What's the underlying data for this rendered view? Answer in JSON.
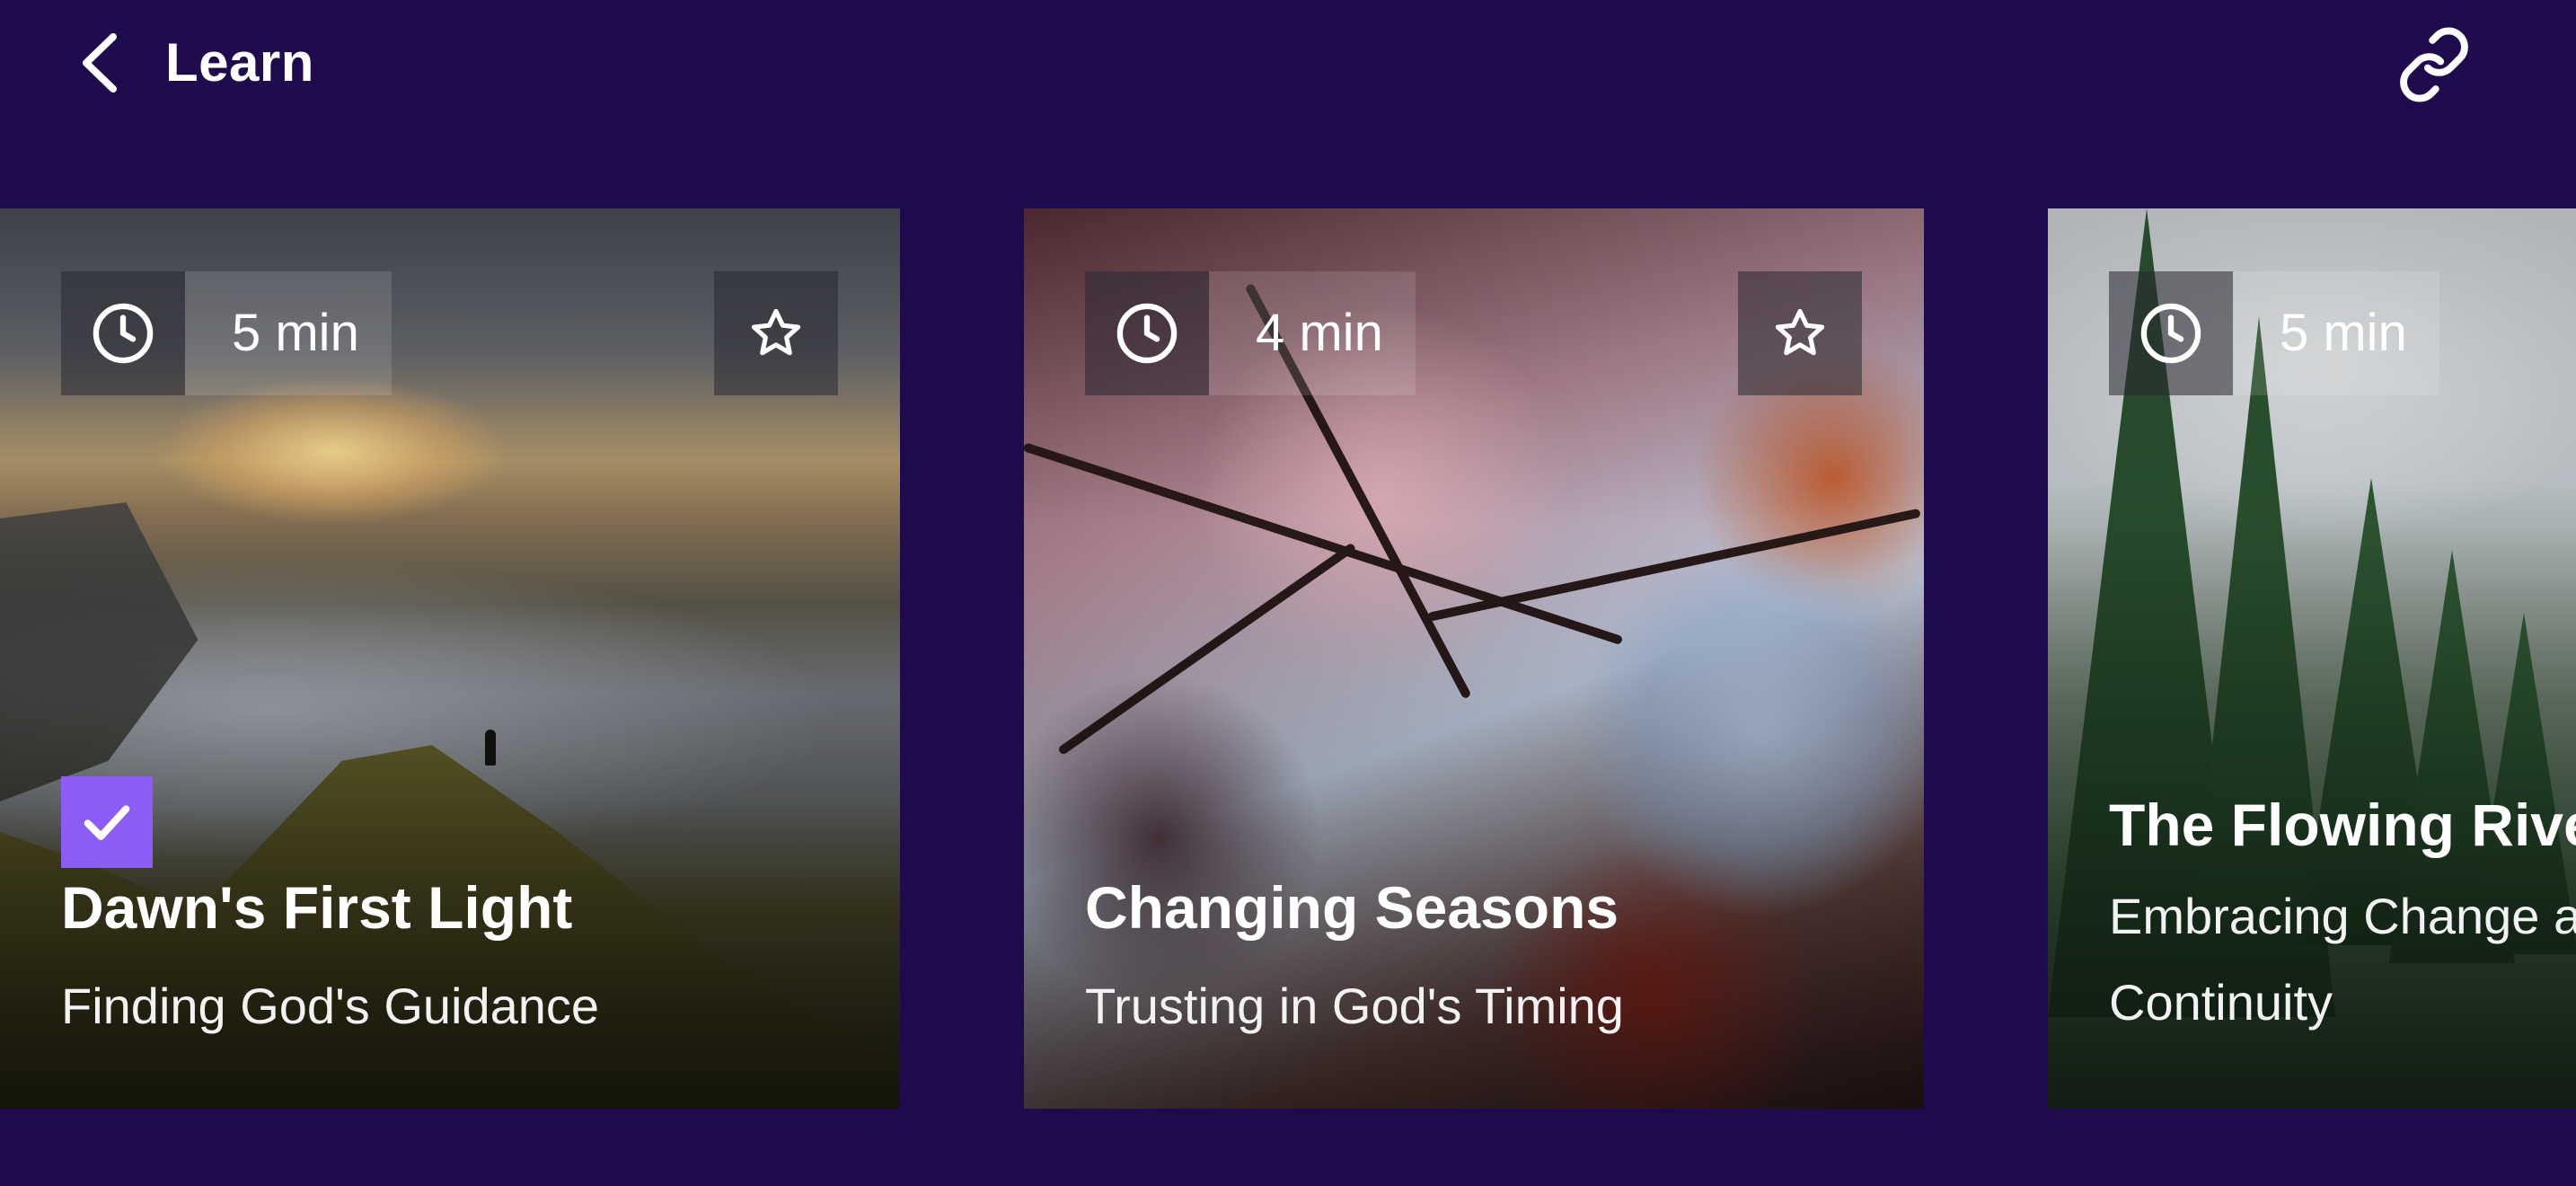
{
  "header": {
    "title": "Learn",
    "back_icon": "chevron-left-icon",
    "link_icon": "link-icon"
  },
  "colors": {
    "background": "#1e0a4d",
    "completed_badge": "#8b5cf6",
    "text": "#ffffff"
  },
  "cards": [
    {
      "duration": "5 min",
      "title": "Dawn's First Light",
      "subtitle": "Finding God's Guidance",
      "completed": true,
      "favorite_visible": true
    },
    {
      "duration": "4 min",
      "title": "Changing Seasons",
      "subtitle": "Trusting in God's Timing",
      "completed": false,
      "favorite_visible": true
    },
    {
      "duration": "5 min",
      "title": "The Flowing River",
      "subtitle": "Embracing Change and Continuity",
      "completed": false,
      "favorite_visible": false
    }
  ]
}
